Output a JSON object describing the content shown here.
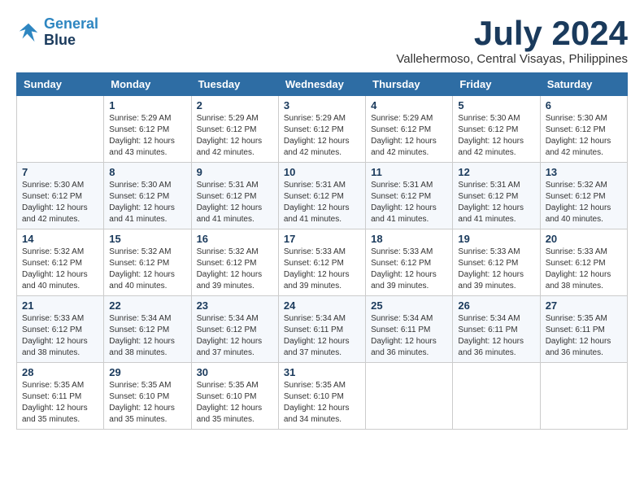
{
  "logo": {
    "line1": "General",
    "line2": "Blue"
  },
  "title": "July 2024",
  "subtitle": "Vallehermoso, Central Visayas, Philippines",
  "weekdays": [
    "Sunday",
    "Monday",
    "Tuesday",
    "Wednesday",
    "Thursday",
    "Friday",
    "Saturday"
  ],
  "weeks": [
    [
      {
        "day": "",
        "info": ""
      },
      {
        "day": "1",
        "info": "Sunrise: 5:29 AM\nSunset: 6:12 PM\nDaylight: 12 hours\nand 43 minutes."
      },
      {
        "day": "2",
        "info": "Sunrise: 5:29 AM\nSunset: 6:12 PM\nDaylight: 12 hours\nand 42 minutes."
      },
      {
        "day": "3",
        "info": "Sunrise: 5:29 AM\nSunset: 6:12 PM\nDaylight: 12 hours\nand 42 minutes."
      },
      {
        "day": "4",
        "info": "Sunrise: 5:29 AM\nSunset: 6:12 PM\nDaylight: 12 hours\nand 42 minutes."
      },
      {
        "day": "5",
        "info": "Sunrise: 5:30 AM\nSunset: 6:12 PM\nDaylight: 12 hours\nand 42 minutes."
      },
      {
        "day": "6",
        "info": "Sunrise: 5:30 AM\nSunset: 6:12 PM\nDaylight: 12 hours\nand 42 minutes."
      }
    ],
    [
      {
        "day": "7",
        "info": "Sunrise: 5:30 AM\nSunset: 6:12 PM\nDaylight: 12 hours\nand 42 minutes."
      },
      {
        "day": "8",
        "info": "Sunrise: 5:30 AM\nSunset: 6:12 PM\nDaylight: 12 hours\nand 41 minutes."
      },
      {
        "day": "9",
        "info": "Sunrise: 5:31 AM\nSunset: 6:12 PM\nDaylight: 12 hours\nand 41 minutes."
      },
      {
        "day": "10",
        "info": "Sunrise: 5:31 AM\nSunset: 6:12 PM\nDaylight: 12 hours\nand 41 minutes."
      },
      {
        "day": "11",
        "info": "Sunrise: 5:31 AM\nSunset: 6:12 PM\nDaylight: 12 hours\nand 41 minutes."
      },
      {
        "day": "12",
        "info": "Sunrise: 5:31 AM\nSunset: 6:12 PM\nDaylight: 12 hours\nand 41 minutes."
      },
      {
        "day": "13",
        "info": "Sunrise: 5:32 AM\nSunset: 6:12 PM\nDaylight: 12 hours\nand 40 minutes."
      }
    ],
    [
      {
        "day": "14",
        "info": "Sunrise: 5:32 AM\nSunset: 6:12 PM\nDaylight: 12 hours\nand 40 minutes."
      },
      {
        "day": "15",
        "info": "Sunrise: 5:32 AM\nSunset: 6:12 PM\nDaylight: 12 hours\nand 40 minutes."
      },
      {
        "day": "16",
        "info": "Sunrise: 5:32 AM\nSunset: 6:12 PM\nDaylight: 12 hours\nand 39 minutes."
      },
      {
        "day": "17",
        "info": "Sunrise: 5:33 AM\nSunset: 6:12 PM\nDaylight: 12 hours\nand 39 minutes."
      },
      {
        "day": "18",
        "info": "Sunrise: 5:33 AM\nSunset: 6:12 PM\nDaylight: 12 hours\nand 39 minutes."
      },
      {
        "day": "19",
        "info": "Sunrise: 5:33 AM\nSunset: 6:12 PM\nDaylight: 12 hours\nand 39 minutes."
      },
      {
        "day": "20",
        "info": "Sunrise: 5:33 AM\nSunset: 6:12 PM\nDaylight: 12 hours\nand 38 minutes."
      }
    ],
    [
      {
        "day": "21",
        "info": "Sunrise: 5:33 AM\nSunset: 6:12 PM\nDaylight: 12 hours\nand 38 minutes."
      },
      {
        "day": "22",
        "info": "Sunrise: 5:34 AM\nSunset: 6:12 PM\nDaylight: 12 hours\nand 38 minutes."
      },
      {
        "day": "23",
        "info": "Sunrise: 5:34 AM\nSunset: 6:12 PM\nDaylight: 12 hours\nand 37 minutes."
      },
      {
        "day": "24",
        "info": "Sunrise: 5:34 AM\nSunset: 6:11 PM\nDaylight: 12 hours\nand 37 minutes."
      },
      {
        "day": "25",
        "info": "Sunrise: 5:34 AM\nSunset: 6:11 PM\nDaylight: 12 hours\nand 36 minutes."
      },
      {
        "day": "26",
        "info": "Sunrise: 5:34 AM\nSunset: 6:11 PM\nDaylight: 12 hours\nand 36 minutes."
      },
      {
        "day": "27",
        "info": "Sunrise: 5:35 AM\nSunset: 6:11 PM\nDaylight: 12 hours\nand 36 minutes."
      }
    ],
    [
      {
        "day": "28",
        "info": "Sunrise: 5:35 AM\nSunset: 6:11 PM\nDaylight: 12 hours\nand 35 minutes."
      },
      {
        "day": "29",
        "info": "Sunrise: 5:35 AM\nSunset: 6:10 PM\nDaylight: 12 hours\nand 35 minutes."
      },
      {
        "day": "30",
        "info": "Sunrise: 5:35 AM\nSunset: 6:10 PM\nDaylight: 12 hours\nand 35 minutes."
      },
      {
        "day": "31",
        "info": "Sunrise: 5:35 AM\nSunset: 6:10 PM\nDaylight: 12 hours\nand 34 minutes."
      },
      {
        "day": "",
        "info": ""
      },
      {
        "day": "",
        "info": ""
      },
      {
        "day": "",
        "info": ""
      }
    ]
  ]
}
